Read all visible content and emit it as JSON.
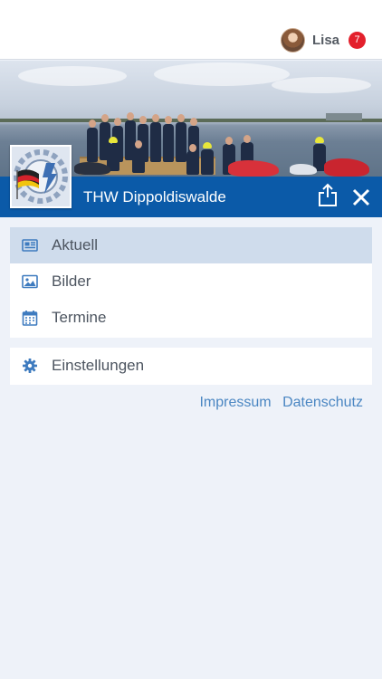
{
  "user": {
    "name": "Lisa",
    "notification_count": "7"
  },
  "organization": {
    "name": "THW Dippoldiswalde"
  },
  "menu": {
    "main_items": [
      {
        "label": "Aktuell",
        "icon": "newspaper-icon",
        "active": true
      },
      {
        "label": "Bilder",
        "icon": "image-icon",
        "active": false
      },
      {
        "label": "Termine",
        "icon": "calendar-icon",
        "active": false
      }
    ],
    "settings_items": [
      {
        "label": "Einstellungen",
        "icon": "gear-icon",
        "active": false
      }
    ]
  },
  "footer_links": {
    "impressum": "Impressum",
    "datenschutz": "Datenschutz"
  },
  "colors": {
    "brand_blue": "#0b5aa8",
    "active_row": "#cfdcec",
    "icon_blue": "#3e7bbf",
    "badge_red": "#e3202c",
    "link_blue": "#4a86c2",
    "background": "#eef2f9"
  }
}
